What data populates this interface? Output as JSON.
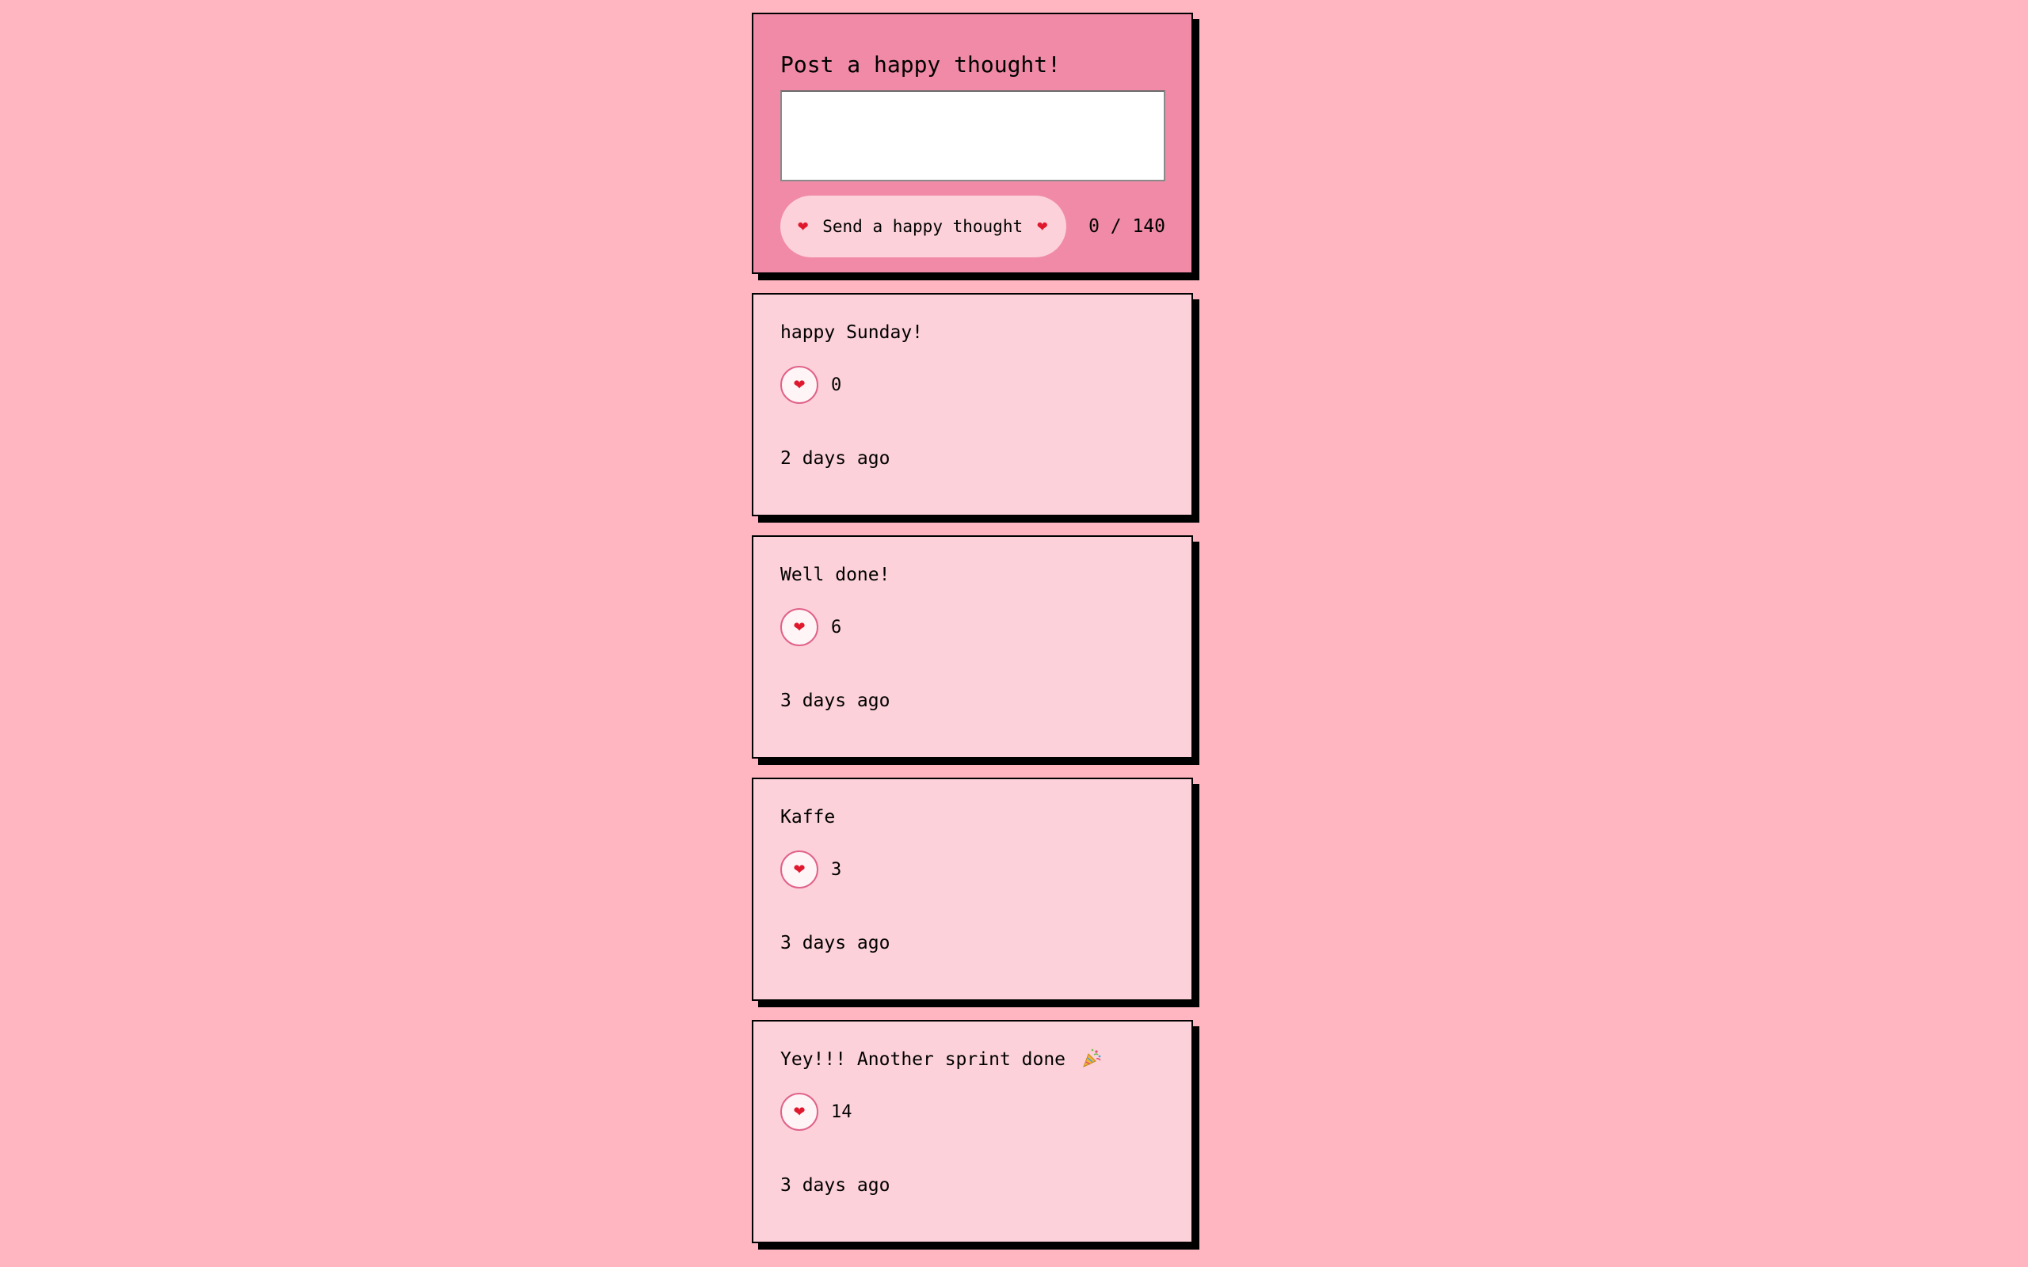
{
  "post_form": {
    "title": "Post a happy thought!",
    "input_value": "",
    "button_label": "Send a happy thought",
    "heart_glyph": "❤",
    "char_count": "0 / 140"
  },
  "thoughts": [
    {
      "message": "happy Sunday!",
      "likes": "0",
      "time": "2 days ago"
    },
    {
      "message": "Well done!",
      "likes": "6",
      "time": "3 days ago"
    },
    {
      "message": "Kaffe",
      "likes": "3",
      "time": "3 days ago"
    },
    {
      "message": "Yey!!! Another sprint done",
      "message_icon": "party-popper-icon",
      "likes": "14",
      "time": "3 days ago"
    }
  ],
  "colors": {
    "background": "#ffb6c1",
    "form_card": "#f08aa7",
    "thought_card": "#fcd1d9",
    "heart": "#e0182d"
  }
}
